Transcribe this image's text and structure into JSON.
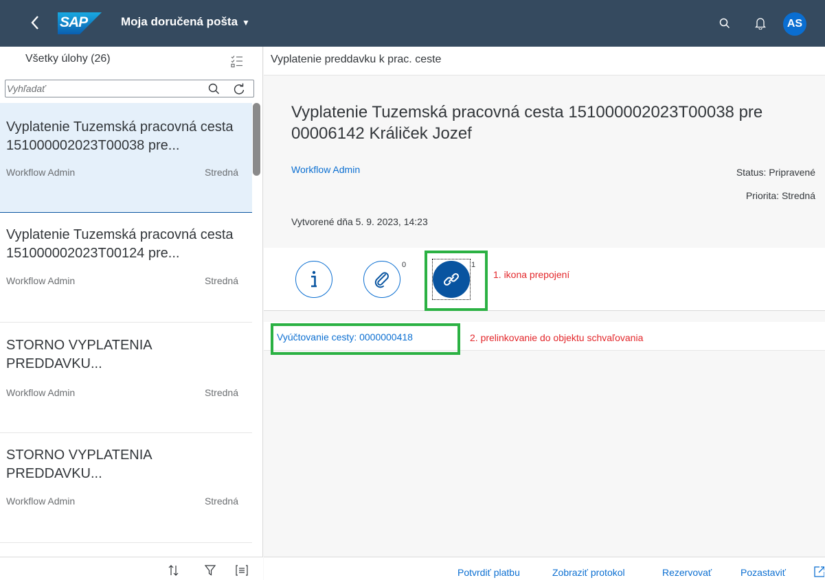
{
  "shell": {
    "logo_text": "SAP",
    "title": "Moja doručená pošta",
    "avatar_initials": "AS"
  },
  "master": {
    "header_label": "Všetky úlohy (26)",
    "search_placeholder": "Vyhľadať",
    "items": [
      {
        "title": "Vyplatenie Tuzemská pracovná cesta 151000002023T00038 pre...",
        "assignee": "Workflow Admin",
        "priority": "Stredná"
      },
      {
        "title": "Vyplatenie Tuzemská pracovná cesta 151000002023T00124 pre...",
        "assignee": "Workflow Admin",
        "priority": "Stredná"
      },
      {
        "title": "STORNO VYPLATENIA PREDDAVKU...",
        "assignee": "Workflow Admin",
        "priority": "Stredná"
      },
      {
        "title": "STORNO VYPLATENIA PREDDAVKU...",
        "assignee": "Workflow Admin",
        "priority": "Stredná"
      }
    ]
  },
  "detail": {
    "header": "Vyplatenie preddavku k prac. ceste",
    "title": "Vyplatenie Tuzemská pracovná cesta 151000002023T00038 pre 00006142 Králiček Jozef",
    "creator": "Workflow Admin",
    "status": "Status: Pripravené",
    "priority": "Priorita: Stredná",
    "created": "Vytvorené dňa 5. 9. 2023, 14:23",
    "tabs": {
      "attachments_count": "0",
      "links_count": "1"
    },
    "link_text": "Vyúčtovanie cesty: 0000000418"
  },
  "annotations": {
    "a1": "1. ikona prepojení",
    "a2": "2. prelinkovanie do objektu schvaľovania"
  },
  "footer_actions": [
    "Potvrdiť platbu",
    "Zobraziť protokol",
    "Rezervovať",
    "Pozastaviť"
  ],
  "colors": {
    "shell_bg": "#354a5f",
    "accent": "#0a6ed1",
    "selected_bg": "#e5f0fa",
    "annotation_box": "#2bb143",
    "annotation_text": "#e3262a"
  }
}
